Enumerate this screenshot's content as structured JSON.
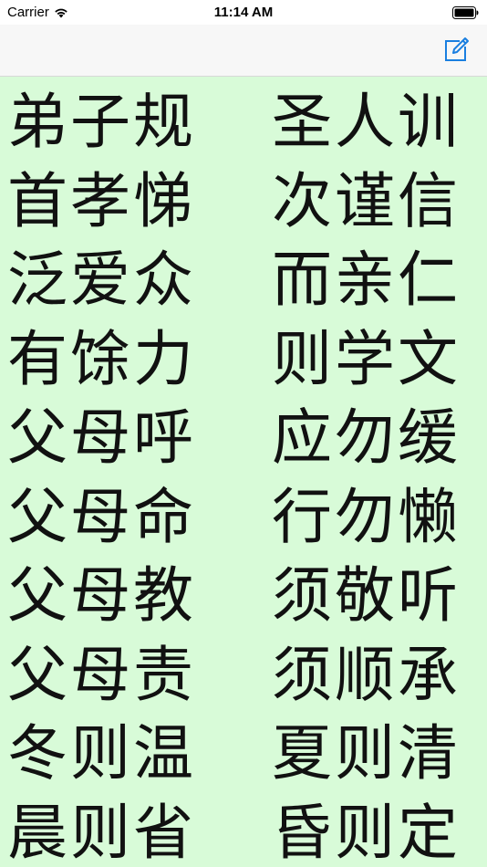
{
  "status_bar": {
    "carrier": "Carrier",
    "time": "11:14 AM",
    "wifi_icon": "wifi-icon",
    "battery_icon": "battery-icon"
  },
  "nav_bar": {
    "compose_icon": "compose-icon",
    "accent_color": "#1a7fe0"
  },
  "content": {
    "background_color": "#d8fbd8",
    "lines": [
      {
        "left": "弟子规",
        "right": "圣人训"
      },
      {
        "left": "首孝悌",
        "right": "次谨信"
      },
      {
        "left": "泛爱众",
        "right": "而亲仁"
      },
      {
        "left": "有馀力",
        "right": "则学文"
      },
      {
        "left": "父母呼",
        "right": "应勿缓"
      },
      {
        "left": "父母命",
        "right": "行勿懒"
      },
      {
        "left": "父母教",
        "right": "须敬听"
      },
      {
        "left": "父母责",
        "right": "须顺承"
      },
      {
        "left": "冬则温",
        "right": "夏则清"
      },
      {
        "left": "晨则省",
        "right": "昏则定"
      }
    ]
  }
}
